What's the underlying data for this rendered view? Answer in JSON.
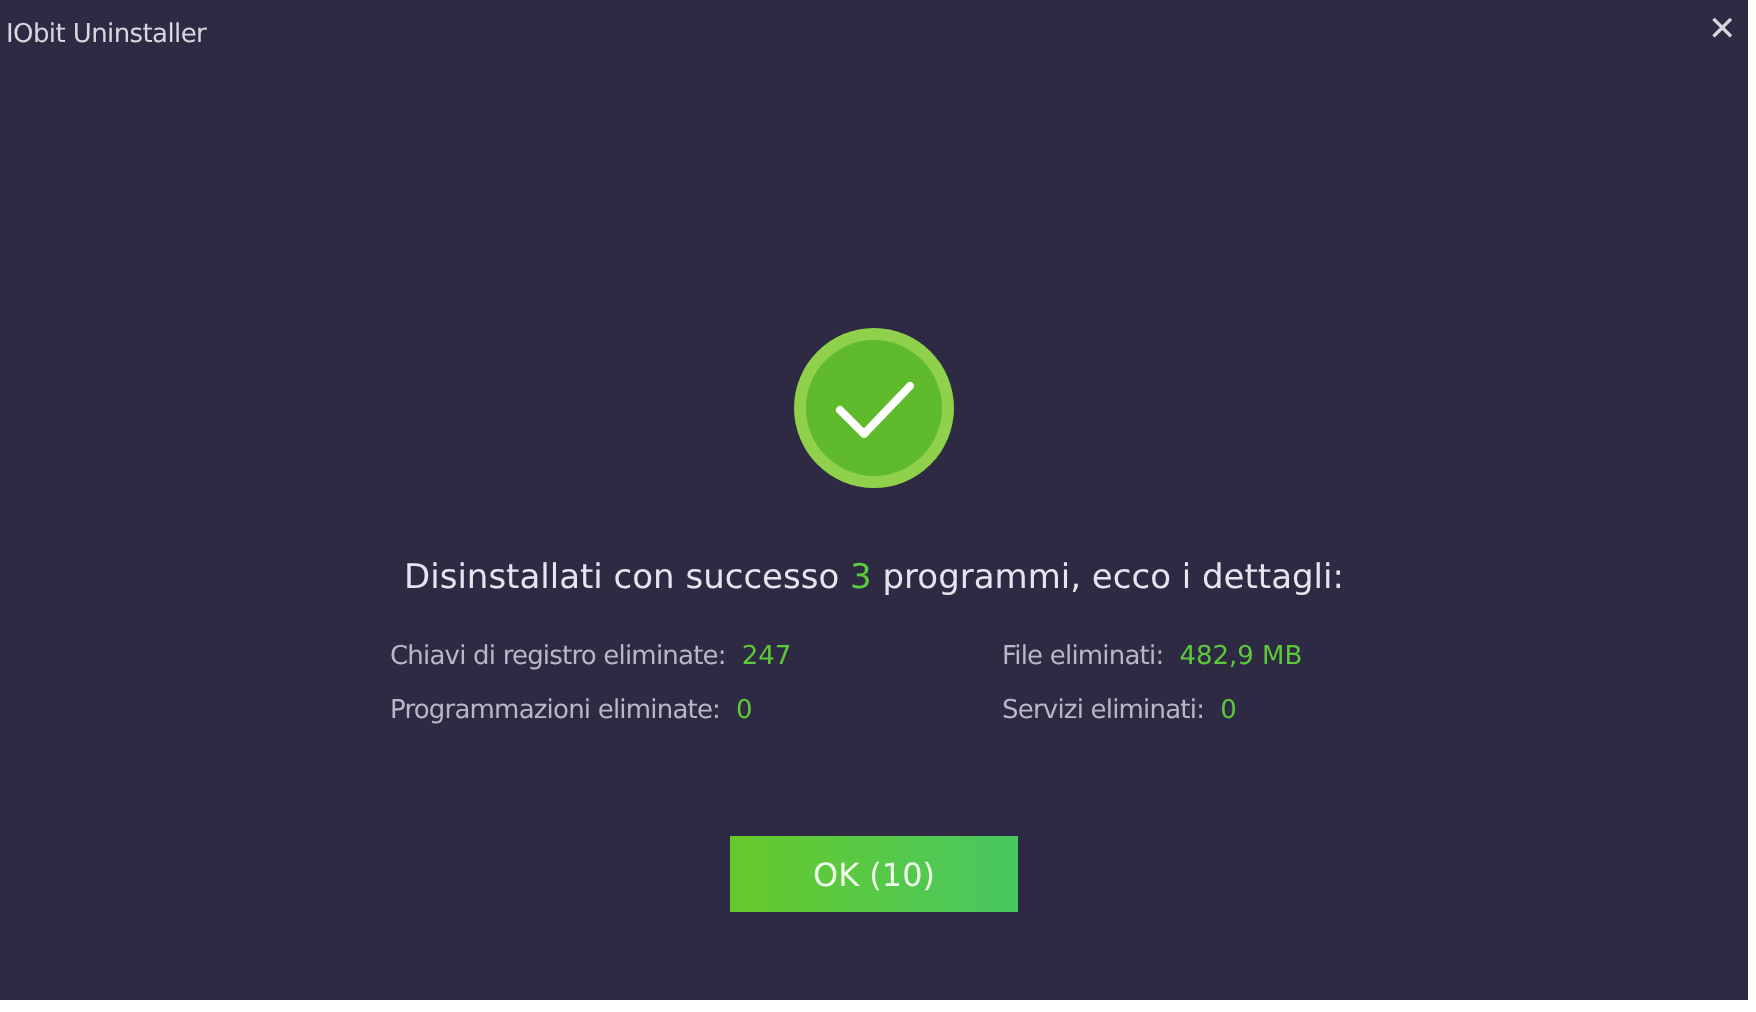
{
  "window": {
    "title": "IObit Uninstaller",
    "close": "✕"
  },
  "headline": {
    "before": "Disinstallati con successo",
    "count": "3",
    "after": "programmi, ecco i dettagli:"
  },
  "stats": [
    {
      "label": "Chiavi di registro eliminate:",
      "value": "247"
    },
    {
      "label": "File eliminati:",
      "value": "482,9 MB"
    },
    {
      "label": "Programmazioni eliminate:",
      "value": "0"
    },
    {
      "label": "Servizi eliminati:",
      "value": "0"
    }
  ],
  "button": {
    "label": "OK (10)"
  }
}
